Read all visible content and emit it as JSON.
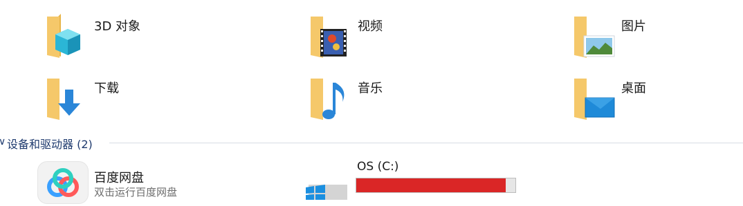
{
  "folders": [
    {
      "label": "3D 对象",
      "icon": "3d-objects-folder-icon"
    },
    {
      "label": "视频",
      "icon": "videos-folder-icon"
    },
    {
      "label": "图片",
      "icon": "pictures-folder-icon"
    },
    {
      "label": "下载",
      "icon": "downloads-folder-icon"
    },
    {
      "label": "音乐",
      "icon": "music-folder-icon"
    },
    {
      "label": "桌面",
      "icon": "desktop-folder-icon"
    }
  ],
  "devices_group": {
    "title": "设备和驱动器 (2)",
    "chevron": "chevron-down-icon"
  },
  "devices": [
    {
      "name": "百度网盘",
      "subtitle": "双击运行百度网盘",
      "icon": "baidu-netdisk-icon"
    },
    {
      "name": "OS (C:)",
      "icon": "windows-drive-icon",
      "usage_fraction": 0.94,
      "bar_color": "#da2626"
    }
  ],
  "colors": {
    "group_header": "#1e3a6e",
    "folder": "#f5c86a",
    "usage_critical": "#da2626"
  }
}
